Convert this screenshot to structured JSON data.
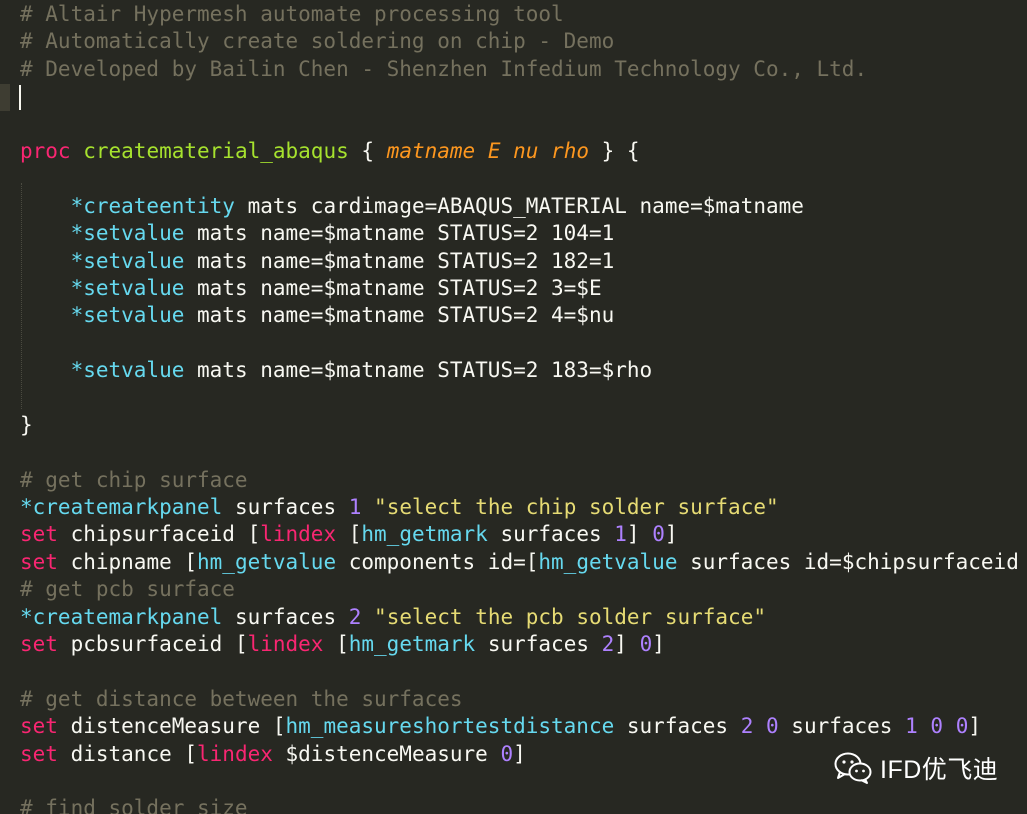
{
  "editor": {
    "lines": [
      [
        [
          "c",
          "# Altair Hypermesh automate processing tool"
        ]
      ],
      [
        [
          "c",
          "# Automatically create soldering on chip - Demo"
        ]
      ],
      [
        [
          "c",
          "# Developed by Bailin Chen - Shenzhen Infedium Technology Co., Ltd."
        ]
      ],
      [],
      [],
      [
        [
          "k",
          "proc"
        ],
        [
          "t",
          " "
        ],
        [
          "f",
          "creatematerial_abaqus"
        ],
        [
          "t",
          " { "
        ],
        [
          "p",
          "matname E nu rho"
        ],
        [
          "t",
          " } {"
        ]
      ],
      [],
      [
        [
          "t",
          "    "
        ],
        [
          "b",
          "*createentity"
        ],
        [
          "t",
          " mats cardimage=ABAQUS_MATERIAL name=$matname"
        ]
      ],
      [
        [
          "t",
          "    "
        ],
        [
          "b",
          "*setvalue"
        ],
        [
          "t",
          " mats name=$matname STATUS=2 104=1"
        ]
      ],
      [
        [
          "t",
          "    "
        ],
        [
          "b",
          "*setvalue"
        ],
        [
          "t",
          " mats name=$matname STATUS=2 182=1"
        ]
      ],
      [
        [
          "t",
          "    "
        ],
        [
          "b",
          "*setvalue"
        ],
        [
          "t",
          " mats name=$matname STATUS=2 3=$E"
        ]
      ],
      [
        [
          "t",
          "    "
        ],
        [
          "b",
          "*setvalue"
        ],
        [
          "t",
          " mats name=$matname STATUS=2 4=$nu"
        ]
      ],
      [],
      [
        [
          "t",
          "    "
        ],
        [
          "b",
          "*setvalue"
        ],
        [
          "t",
          " mats name=$matname STATUS=2 183=$rho"
        ]
      ],
      [],
      [
        [
          "t",
          "}"
        ]
      ],
      [],
      [
        [
          "c",
          "# get chip surface"
        ]
      ],
      [
        [
          "b",
          "*createmarkpanel"
        ],
        [
          "t",
          " surfaces "
        ],
        [
          "n",
          "1"
        ],
        [
          "t",
          " "
        ],
        [
          "s",
          "\"select the chip solder surface\""
        ]
      ],
      [
        [
          "k",
          "set"
        ],
        [
          "t",
          " chipsurfaceid ["
        ],
        [
          "k",
          "lindex"
        ],
        [
          "t",
          " ["
        ],
        [
          "b",
          "hm_getmark"
        ],
        [
          "t",
          " surfaces "
        ],
        [
          "n",
          "1"
        ],
        [
          "t",
          "] "
        ],
        [
          "n",
          "0"
        ],
        [
          "t",
          "]"
        ]
      ],
      [
        [
          "k",
          "set"
        ],
        [
          "t",
          " chipname ["
        ],
        [
          "b",
          "hm_getvalue"
        ],
        [
          "t",
          " components id=["
        ],
        [
          "b",
          "hm_getvalue"
        ],
        [
          "t",
          " surfaces id=$chipsurfaceid"
        ]
      ],
      [
        [
          "c",
          "# get pcb surface"
        ]
      ],
      [
        [
          "b",
          "*createmarkpanel"
        ],
        [
          "t",
          " surfaces "
        ],
        [
          "n",
          "2"
        ],
        [
          "t",
          " "
        ],
        [
          "s",
          "\"select the pcb solder surface\""
        ]
      ],
      [
        [
          "k",
          "set"
        ],
        [
          "t",
          " pcbsurfaceid ["
        ],
        [
          "k",
          "lindex"
        ],
        [
          "t",
          " ["
        ],
        [
          "b",
          "hm_getmark"
        ],
        [
          "t",
          " surfaces "
        ],
        [
          "n",
          "2"
        ],
        [
          "t",
          "] "
        ],
        [
          "n",
          "0"
        ],
        [
          "t",
          "]"
        ]
      ],
      [],
      [
        [
          "c",
          "# get distance between the surfaces"
        ]
      ],
      [
        [
          "k",
          "set"
        ],
        [
          "t",
          " distenceMeasure ["
        ],
        [
          "b",
          "hm_measureshortestdistance"
        ],
        [
          "t",
          " surfaces "
        ],
        [
          "n",
          "2"
        ],
        [
          "t",
          " "
        ],
        [
          "n",
          "0"
        ],
        [
          "t",
          " surfaces "
        ],
        [
          "n",
          "1"
        ],
        [
          "t",
          " "
        ],
        [
          "n",
          "0"
        ],
        [
          "t",
          " "
        ],
        [
          "n",
          "0"
        ],
        [
          "t",
          "]"
        ]
      ],
      [
        [
          "k",
          "set"
        ],
        [
          "t",
          " distance ["
        ],
        [
          "k",
          "lindex"
        ],
        [
          "t",
          " $distenceMeasure "
        ],
        [
          "n",
          "0"
        ],
        [
          "t",
          "]"
        ]
      ],
      [],
      [
        [
          "c",
          "# find solder size"
        ]
      ]
    ]
  },
  "watermark": {
    "text": "IFD优飞迪",
    "icon": "wechat-icon"
  }
}
